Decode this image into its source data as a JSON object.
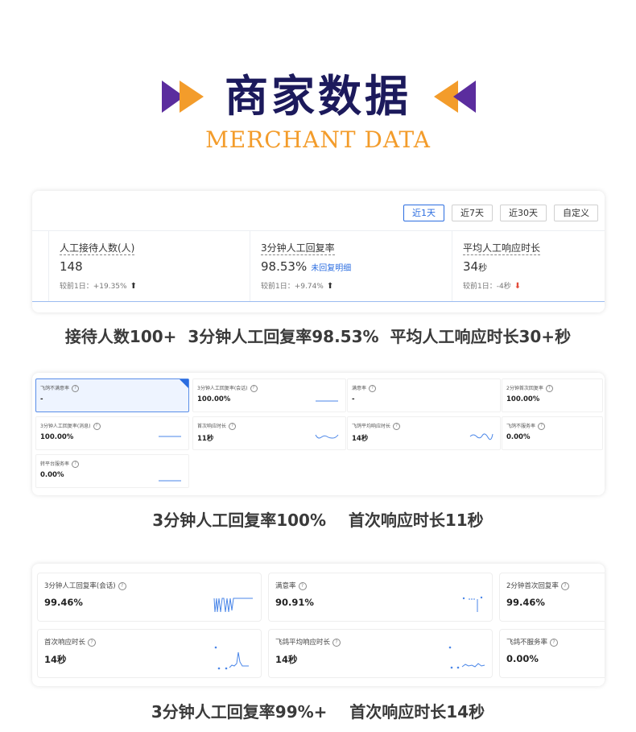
{
  "header": {
    "title": "商家数据",
    "subtitle": "MERCHANT DATA",
    "colors": {
      "title": "#1c1a5c",
      "subtitle": "#f39c2b",
      "purple": "#5b2d9e",
      "orange": "#f39c2b"
    }
  },
  "card1": {
    "ranges": [
      "近1天",
      "近7天",
      "近30天",
      "自定义"
    ],
    "active_range": "近1天",
    "metrics": [
      {
        "label": "人工接待人数(人)",
        "value": "148",
        "unit": "",
        "link": "",
        "comparison": "较前1日：+19.35%",
        "trend": "up"
      },
      {
        "label": "3分钟人工回复率",
        "value": "98.53%",
        "unit": "",
        "link": "未回复明细",
        "comparison": "较前1日：+9.74%",
        "trend": "up"
      },
      {
        "label": "平均人工响应时长",
        "value": "34",
        "unit": "秒",
        "link": "",
        "comparison": "较前1日：-4秒",
        "trend": "down"
      }
    ],
    "caption": "接待人数100+  3分钟人工回复率98.53%  平均人工响应时长30+秒"
  },
  "card2": {
    "tiles": [
      {
        "label": "飞鸽不满意率",
        "value": "-",
        "selected": true,
        "spark": "none"
      },
      {
        "label": "3分钟人工回复率(会话)",
        "value": "100.00%",
        "selected": false,
        "spark": "flat"
      },
      {
        "label": "满意率",
        "value": "-",
        "selected": false,
        "spark": "none"
      },
      {
        "label": "2分钟首次回复率",
        "value": "100.00%",
        "selected": false,
        "spark": "none"
      },
      {
        "label": "3分钟人工回复率(消息)",
        "value": "100.00%",
        "selected": false,
        "spark": "flat"
      },
      {
        "label": "首次响应时长",
        "value": "11秒",
        "selected": false,
        "spark": "wave"
      },
      {
        "label": "飞鸽平均响应时长",
        "value": "14秒",
        "selected": false,
        "spark": "wave"
      },
      {
        "label": "飞鸽不服务率",
        "value": "0.00%",
        "selected": false,
        "spark": "none"
      },
      {
        "label": "转平台服务率",
        "value": "0.00%",
        "selected": false,
        "spark": "flat"
      }
    ],
    "caption": "3分钟人工回复率100%    首次响应时长11秒"
  },
  "card3": {
    "tiles": [
      {
        "label": "3分钟人工回复率(会话)",
        "value": "99.46%",
        "spark": "dips"
      },
      {
        "label": "满意率",
        "value": "90.91%",
        "spark": "dots-drop"
      },
      {
        "label": "2分钟首次回复率",
        "value": "99.46%",
        "spark": "none"
      },
      {
        "label": "首次响应时长",
        "value": "14秒",
        "spark": "spike"
      },
      {
        "label": "飞鸽平均响应时长",
        "value": "14秒",
        "spark": "dots-wave"
      },
      {
        "label": "飞鸽不服务率",
        "value": "0.00%",
        "spark": "none"
      }
    ],
    "caption": "3分钟人工回复率99%+    首次响应时长14秒"
  }
}
